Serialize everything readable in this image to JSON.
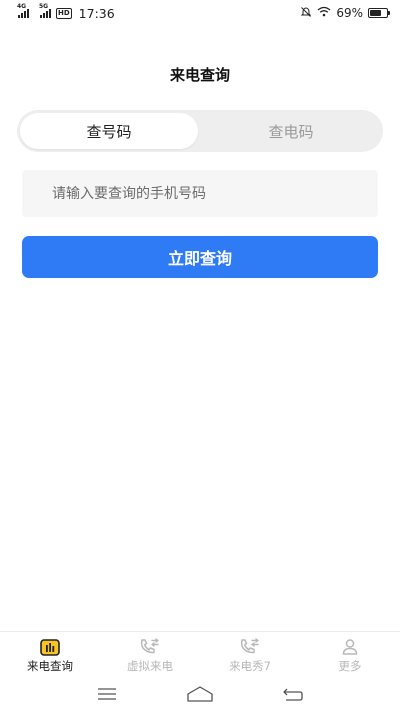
{
  "status_bar": {
    "network_1": "4G",
    "network_2": "5G",
    "hd_badge": "HD",
    "time": "17:36",
    "battery_percent": "69%",
    "battery_level": 0.69,
    "icons": [
      "signal-icon",
      "hd-icon",
      "mute-icon",
      "wifi-icon",
      "battery-icon"
    ]
  },
  "header": {
    "title": "来电查询"
  },
  "segment": {
    "tabs": [
      {
        "label": "查号码",
        "active": true
      },
      {
        "label": "查电码",
        "active": false
      }
    ]
  },
  "search": {
    "placeholder": "请输入要查询的手机号码",
    "value": ""
  },
  "actions": {
    "query_label": "立即查询"
  },
  "colors": {
    "primary": "#2f7bf5",
    "active_tab_icon": "#f7c325",
    "inactive": "#b8b8b8"
  },
  "tabbar": {
    "items": [
      {
        "label": "来电查询",
        "icon": "bar-chart-icon",
        "active": true
      },
      {
        "label": "虚拟来电",
        "icon": "phone-transfer-icon",
        "active": false
      },
      {
        "label": "来电秀7",
        "icon": "phone-transfer-icon",
        "active": false
      },
      {
        "label": "更多",
        "icon": "user-icon",
        "active": false
      }
    ]
  },
  "navbar": {
    "icons": [
      "menu-icon",
      "home-icon",
      "back-icon"
    ]
  }
}
